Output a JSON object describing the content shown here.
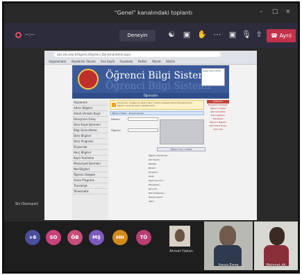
{
  "window": {
    "title": "\"Genel\" kanalındaki toplantı",
    "controls": [
      "–",
      "□",
      "×"
    ]
  },
  "meeting": {
    "timer": "--:--",
    "try_button": "Deneyin",
    "leave_button": "Ayrıl",
    "accent": "#c4314b"
  },
  "browser": {
    "url": "obs.sdu.edu.tr/Ogrenci/Ogrenci_DanismanIslem.aspx",
    "bookmarks": [
      "Uygulamalar",
      "Akademik Takvim",
      "Ana Sayfa",
      "Facebook",
      "Twitter",
      "Mynet",
      "Sözlük"
    ]
  },
  "site": {
    "title": "Öğrenci Bilgi Sistemi",
    "title_shadow": "Öğrenci Bilgi Sistemi",
    "nav_title": "Öğrenciler",
    "session_text": "Kalan Süre 19:56",
    "left_menu": [
      "Akademik",
      "Adres Bilgileri",
      "Anket (Anket) Kayıt",
      "Danışman Onay",
      "Ders Kayıt İşlemleri",
      "Bilgi Güncelleme",
      "Ders Bilgileri",
      "Ders Programı",
      "Duyurular",
      "Harç Bilgileri",
      "Kayıt Yenileme",
      "Mezuniyet İşlemleri",
      "Not Bilgileri",
      "Öğrenci Belgesi",
      "Sınav Programı",
      "Transkript",
      "Yönetmelik"
    ],
    "notice": "Danışmanı olduğunuz öğrencilerin listesini aşağıda görüntüleyebilirsiniz. Öğrenci seçerek işlem yapabilirsiniz.",
    "blue_strip": "Öğrenci listesi - dönem seçiniz",
    "field_labels": [
      "Dönem",
      "Öğrenci"
    ],
    "search_text": "Öğrenci Seç / Listele",
    "details": [
      "Öğrenci Numarası :",
      "Adı Soyadı :",
      "Fakülte :",
      "Bölüm :",
      "Program :",
      "Sınıfı :",
      "Kayıt Durumu :",
      "Danışmanı :",
      "Giriş Yılı :",
      "Not Ortalaması :",
      "Toplam Kredi :",
      "AKTS :"
    ],
    "right_menu_title": "İşlemler",
    "right_menu": [
      "Danışman Onayları",
      "Öğrenci Listesi",
      "Not Görüntüle",
      "Ders Kayıtları",
      "Transkript",
      "Öğrenci Bilgileri",
      "Ders Kayıt Onayı",
      "Çıkış Yap"
    ]
  },
  "presenter_label": "Siz (Sunuyor)",
  "participants": [
    {
      "initials": "+6",
      "color": "#4a4f9c"
    },
    {
      "initials": "SO",
      "color": "#c8417a"
    },
    {
      "initials": "ÖB",
      "color": "#c84d7b"
    },
    {
      "initials": "MŞ",
      "color": "#7c5bbf"
    },
    {
      "initials": "HH",
      "color": "#d48a1b"
    },
    {
      "initials": "TÖ",
      "color": "#b93e74"
    }
  ],
  "photo_tile_label": "Ahmet Hakan",
  "video_tiles": [
    "Yunus Emre",
    "Mehmet Ali"
  ]
}
